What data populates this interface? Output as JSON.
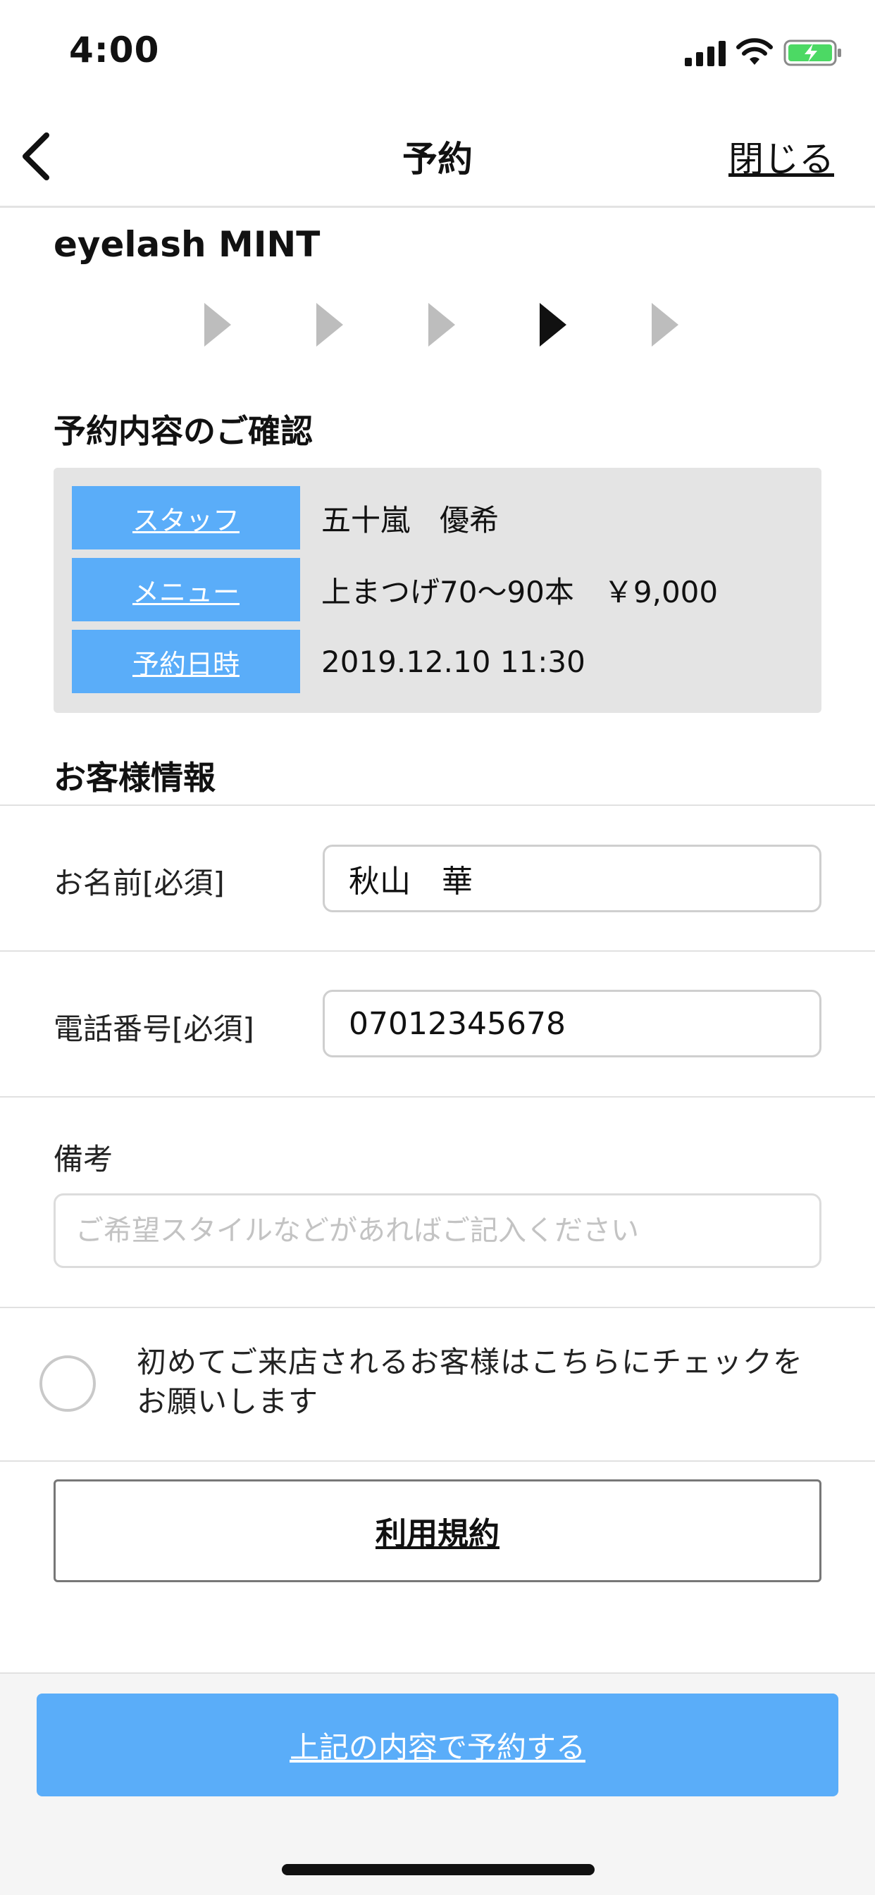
{
  "status_bar": {
    "time": "4:00"
  },
  "nav": {
    "title": "予約",
    "close_label": "閉じる"
  },
  "shop": {
    "name": "eyelash MINT"
  },
  "steps": {
    "count": 5,
    "active_index": 4
  },
  "confirmation": {
    "title": "予約内容のご確認",
    "rows": [
      {
        "label": "スタッフ",
        "value": "五十嵐　優希"
      },
      {
        "label": "メニュー",
        "value": "上まつげ70〜90本　￥9,000"
      },
      {
        "label": "予約日時",
        "value": "2019.12.10 11:30"
      }
    ]
  },
  "customer": {
    "title": "お客様情報",
    "name_label": "お名前[必須]",
    "name_value": "秋山　華",
    "phone_label": "電話番号[必須]",
    "phone_value": "07012345678",
    "remarks_label": "備考",
    "remarks_placeholder": "ご希望スタイルなどがあればご記入ください"
  },
  "first_visit": {
    "line1": "初めてご来店されるお客様はこちらにチェックを",
    "line2": "お願いします",
    "checked": false
  },
  "terms": {
    "label": "利用規約"
  },
  "submit": {
    "label": "上記の内容で予約する"
  },
  "colors": {
    "accent": "#5aadf9",
    "confirm_bg": "#e4e4e4",
    "step_inactive": "#bdbdbd",
    "step_active": "#111111"
  }
}
